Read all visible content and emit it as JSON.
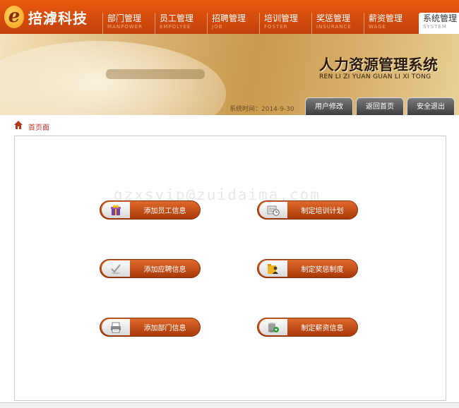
{
  "app": {
    "logo_letter": "e",
    "logo_text": "掊滹科技"
  },
  "nav": {
    "items": [
      {
        "label": "部门管理",
        "sub": "MANPOWER"
      },
      {
        "label": "员工管理",
        "sub": "EMPOLYEE"
      },
      {
        "label": "招聘管理",
        "sub": "JOB"
      },
      {
        "label": "培训管理",
        "sub": "FOSTER"
      },
      {
        "label": "奖惩管理",
        "sub": "INSURANCE"
      },
      {
        "label": "薪资管理",
        "sub": "WAGE"
      },
      {
        "label": "系统管理",
        "sub": "SYSTEM",
        "active": true
      }
    ]
  },
  "banner": {
    "title": "人力资源管理系统",
    "subtitle": "REN LI ZI YUAN GUAN LI XI TONG",
    "system_time": "系统时间：2014-9-30"
  },
  "toolbar": {
    "user_edit": "用户修改",
    "back_home": "返回首页",
    "logout": "安全退出"
  },
  "breadcrumb": {
    "home": "首页面"
  },
  "watermark": "gzxsvip@zuidaima.com",
  "actions": [
    {
      "label": "添加员工信息",
      "icon": "gift-box-icon"
    },
    {
      "label": "制定培训计划",
      "icon": "schedule-clock-icon"
    },
    {
      "label": "添加应聘信息",
      "icon": "pen-check-icon"
    },
    {
      "label": "制定奖惩制度",
      "icon": "folder-person-icon"
    },
    {
      "label": "添加部门信息",
      "icon": "printer-icon"
    },
    {
      "label": "制定薪资信息",
      "icon": "database-download-icon"
    }
  ],
  "colors": {
    "accent": "#c2410c",
    "nav_bg": "#d2500f",
    "button_dark": "#3d3d3d",
    "crumb_red": "#c0392b"
  }
}
